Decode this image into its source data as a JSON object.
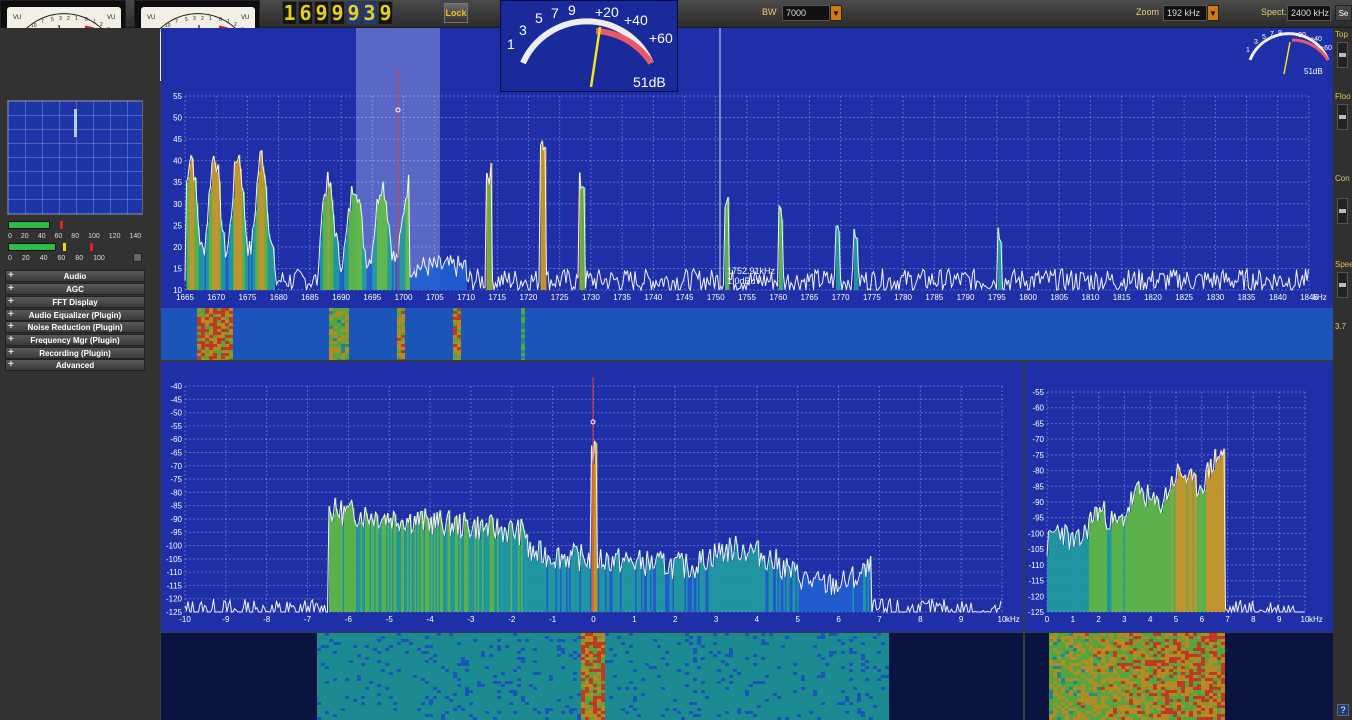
{
  "topbar": {
    "frequency_digits": [
      "1",
      "6",
      "9",
      "9",
      "9",
      "3",
      "9"
    ],
    "selected_digit_indexes": [
      4,
      5
    ],
    "lock_label": "Lock",
    "bw_label": "BW",
    "bw_value": "7000",
    "zoom_label": "Zoom",
    "zoom_value": "192 kHz",
    "spect_label": "Spect.",
    "spect_value": "2400 kHz",
    "set_label": "Se"
  },
  "vu_meters": [
    {
      "label": "VU",
      "scale": [
        "20",
        "10",
        "7",
        "5",
        "3",
        "2",
        "1",
        "0",
        "1",
        "2",
        "3"
      ]
    },
    {
      "label": "VU",
      "scale": [
        "20",
        "10",
        "7",
        "5",
        "3",
        "2",
        "1",
        "0",
        "1",
        "2",
        "3"
      ]
    }
  ],
  "s_meter": {
    "scale": [
      "1",
      "3",
      "5",
      "7",
      "9",
      "+20",
      "+40",
      "+60"
    ],
    "reading": "51dB"
  },
  "mini_meter": {
    "scale": [
      "1",
      "3",
      "5",
      "7",
      "9",
      "+20",
      "+40",
      "+60"
    ],
    "reading": "51dB"
  },
  "level_scale": [
    "0",
    "20",
    "40",
    "60",
    "80",
    "100",
    "120",
    "140"
  ],
  "level_scale2": [
    "0",
    "20",
    "40",
    "60",
    "80",
    "100"
  ],
  "menu": [
    {
      "label": "Audio"
    },
    {
      "label": "AGC"
    },
    {
      "label": "FFT Display"
    },
    {
      "label": "Audio Equalizer (Plugin)"
    },
    {
      "label": "Noise Reduction (Plugin)"
    },
    {
      "label": "Frequency Mgr (Plugin)"
    },
    {
      "label": "Recording (Plugin)"
    },
    {
      "label": "Advanced"
    }
  ],
  "right_strip": {
    "top": "Top",
    "floor": "Floo",
    "contrast": "Con",
    "speed": "Spee",
    "value": "3.7"
  },
  "main_spectrum": {
    "y_labels": [
      "55",
      "50",
      "45",
      "40",
      "35",
      "30",
      "25",
      "20",
      "15",
      "10"
    ],
    "x_labels": [
      "1665",
      "1670",
      "1675",
      "1680",
      "1685",
      "1690",
      "1695",
      "1700",
      "1705",
      "1710",
      "1715",
      "1720",
      "1725",
      "1730",
      "1735",
      "1740",
      "1745",
      "1750",
      "1755",
      "1760",
      "1765",
      "1770",
      "1775",
      "1780",
      "1785",
      "1790",
      "1795",
      "1800",
      "1805",
      "1810",
      "1815",
      "1820",
      "1825",
      "1830",
      "1835",
      "1840",
      "1845"
    ],
    "x_unit": "kHz",
    "marker_freq": "1752.91kHz",
    "marker_level": "1.0dBuV"
  },
  "audio_spectrum": {
    "y_labels": [
      "-40",
      "-45",
      "-50",
      "-55",
      "-60",
      "-65",
      "-70",
      "-75",
      "-80",
      "-85",
      "-90",
      "-95",
      "-100",
      "-105",
      "-110",
      "-115",
      "-120",
      "-125"
    ],
    "x_labels": [
      "-10",
      "-9",
      "-8",
      "-7",
      "-6",
      "-5",
      "-4",
      "-3",
      "-2",
      "-1",
      "0",
      "1",
      "2",
      "3",
      "4",
      "5",
      "6",
      "7",
      "8",
      "9",
      "10"
    ],
    "x_unit": "kHz"
  },
  "output_spectrum": {
    "y_labels": [
      "-55",
      "-60",
      "-65",
      "-70",
      "-75",
      "-80",
      "-85",
      "-90",
      "-95",
      "-100",
      "-105",
      "-110",
      "-115",
      "-120",
      "-125"
    ],
    "x_labels": [
      "0",
      "1",
      "2",
      "3",
      "4",
      "5",
      "6",
      "7",
      "8",
      "9",
      "10"
    ],
    "x_unit": "kHz"
  },
  "help_label": "?"
}
